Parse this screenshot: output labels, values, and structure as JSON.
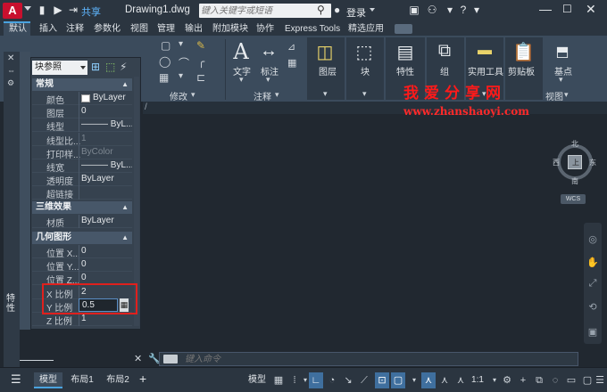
{
  "app": {
    "logo_letter": "A",
    "share": "共享",
    "document_title": "Drawing1.dwg",
    "login": "登录"
  },
  "search": {
    "placeholder": "键入关键字或短语"
  },
  "ribbon_tabs": [
    "默认",
    "插入",
    "注释",
    "参数化",
    "视图",
    "管理",
    "输出",
    "附加模块",
    "协作",
    "Express Tools",
    "精选应用"
  ],
  "ribbon": {
    "panels": {
      "modify": "修改",
      "annotation": "注释",
      "view": "视图"
    },
    "tools": {
      "text": "文字",
      "dimension": "标注",
      "layers": "图层",
      "block": "块",
      "properties": "特性",
      "group": "组",
      "utilities": "实用工具",
      "clipboard": "剪贴板",
      "basepoint": "基点"
    }
  },
  "palette": {
    "selector": "块参照",
    "side_label": "特性",
    "sections": {
      "general": "常规",
      "3d": "三维效果",
      "geometry": "几何图形"
    },
    "general_rows": [
      {
        "key": "颜色",
        "value": "ByLayer"
      },
      {
        "key": "图层",
        "value": "0"
      },
      {
        "key": "线型",
        "value": "——— ByL..."
      },
      {
        "key": "线型比...",
        "value": "1"
      },
      {
        "key": "打印样...",
        "value": "ByColor"
      },
      {
        "key": "线宽",
        "value": "——— ByL..."
      },
      {
        "key": "透明度",
        "value": "ByLayer"
      },
      {
        "key": "超链接",
        "value": ""
      }
    ],
    "three_d_rows": [
      {
        "key": "材质",
        "value": "ByLayer"
      }
    ],
    "geometry_rows": [
      {
        "key": "位置 X...",
        "value": "0"
      },
      {
        "key": "位置 Y...",
        "value": "0"
      },
      {
        "key": "位置 Z...",
        "value": "0"
      },
      {
        "key": "X 比例",
        "value": "2"
      },
      {
        "key": "Y 比例",
        "value": "0.5"
      },
      {
        "key": "Z 比例",
        "value": "1"
      }
    ]
  },
  "watermark": {
    "title": "我爱分享网",
    "url": "www.zhanshaoyi.com"
  },
  "viewcube": {
    "north": "北",
    "south": "南",
    "east": "东",
    "west": "西",
    "face": "上",
    "wcs": "WCS"
  },
  "command": {
    "placeholder": "键入命令"
  },
  "status": {
    "model_tab": "模型",
    "layout1": "布局1",
    "layout2": "布局2",
    "model_button": "模型",
    "scale": "1:1"
  },
  "colors": {
    "accent": "#4aa3df",
    "highlight": "#e0201d",
    "watermark": "#ff1a1a",
    "app_red": "#c8102e"
  }
}
